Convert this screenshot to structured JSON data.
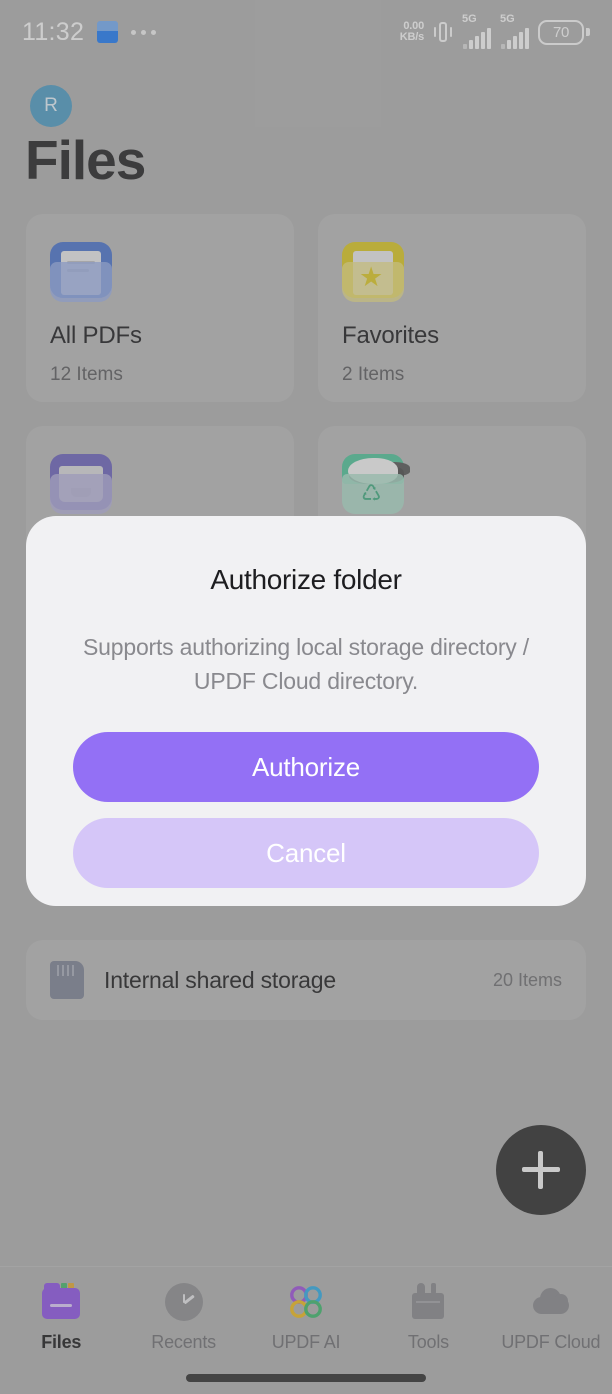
{
  "status_bar": {
    "time": "11:32",
    "app_icon": "facebook-icon",
    "more_notifications_icon": "ellipsis-icon",
    "network_speed_value": "0.00",
    "network_speed_unit": "KB/s",
    "vibrate_icon": "vibrate-icon",
    "sim1_network": "5G",
    "sim2_network": "5G",
    "battery_percent": "70"
  },
  "header": {
    "avatar_initial": "R",
    "title": "Files"
  },
  "cards": [
    {
      "title": "All PDFs",
      "count": "12 Items",
      "icon": "blue-folder-icon"
    },
    {
      "title": "Favorites",
      "count": "2 Items",
      "icon": "yellow-star-folder-icon"
    },
    {
      "title": "",
      "count": "",
      "icon": "purple-inbox-icon"
    },
    {
      "title": "",
      "count": "",
      "icon": "green-recycle-bin-icon"
    }
  ],
  "storage": {
    "icon": "sd-card-icon",
    "label": "Internal shared storage",
    "count": "20 Items"
  },
  "fab": {
    "icon": "plus-icon"
  },
  "bottom_nav": [
    {
      "label": "Files",
      "icon": "folder-icon",
      "active": true
    },
    {
      "label": "Recents",
      "icon": "clock-icon",
      "active": false
    },
    {
      "label": "UPDF AI",
      "icon": "updf-ai-icon",
      "active": false
    },
    {
      "label": "Tools",
      "icon": "toolbox-icon",
      "active": false
    },
    {
      "label": "UPDF Cloud",
      "icon": "cloud-icon",
      "active": false
    }
  ],
  "dialog": {
    "title": "Authorize folder",
    "message": "Supports authorizing local storage directory / UPDF Cloud directory.",
    "authorize_label": "Authorize",
    "cancel_label": "Cancel"
  },
  "colors": {
    "accent_purple": "#9370F5",
    "cancel_purple": "#D5C6F8",
    "background": "#ADADAD",
    "dialog_bg": "#F1F1F3",
    "avatar_blue": "#4C98BF"
  }
}
